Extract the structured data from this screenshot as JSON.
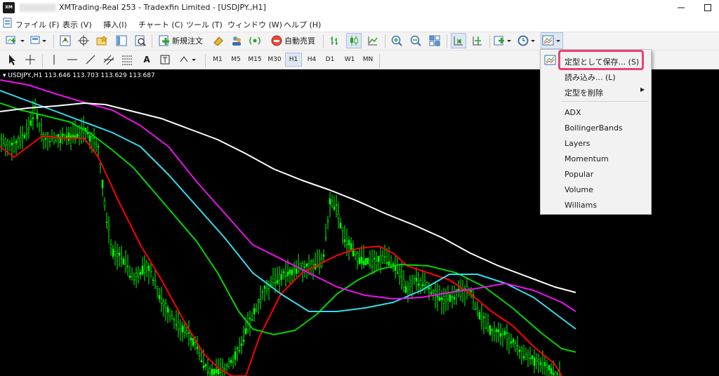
{
  "window": {
    "title": "XMTrading-Real 253 - Tradexfin Limited - [USDJPY.,H1]",
    "logo_text": "XM"
  },
  "menu": {
    "items": [
      "ファイル (F)",
      "表示 (V)",
      "挿入(I)",
      "チャート (C)",
      "ツール (T)",
      "ウィンドウ (W)",
      "ヘルプ (H)"
    ]
  },
  "toolbar": {
    "new_order_label": "新規注文",
    "auto_trading_label": "自動売買"
  },
  "timeframes": [
    "M1",
    "M5",
    "M15",
    "M30",
    "H1",
    "H4",
    "D1",
    "W1",
    "MN"
  ],
  "active_timeframe": "H1",
  "chart": {
    "symbol_info": "USDJPY.,H1  113.646 113.703 113.629 113.687",
    "background": "#000000",
    "candle_color": "#00ff00",
    "ma_colors": {
      "red": "#ff0000",
      "green": "#00d600",
      "cyan": "#33ddee",
      "magenta": "#ee11ee",
      "white": "#ffffff"
    }
  },
  "template_menu": {
    "save": "定型として保存... (S)",
    "load": "読み込み... (L)",
    "delete": "定型を削除",
    "templates": [
      "ADX",
      "BollingerBands",
      "Layers",
      "Momentum",
      "Popular",
      "Volume",
      "Williams"
    ],
    "highlight_color": "#e8427a"
  }
}
